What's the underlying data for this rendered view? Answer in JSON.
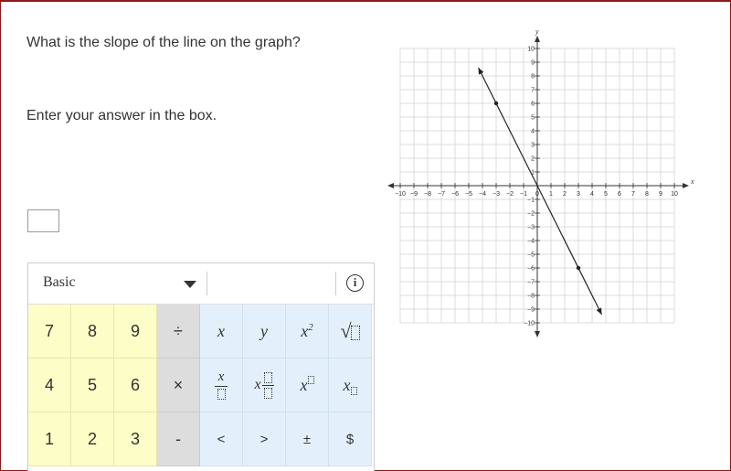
{
  "question": {
    "text": "What is the slope of the line on the graph?",
    "instruction": "Enter your answer in the box."
  },
  "answer_box": {
    "value": ""
  },
  "keyboard": {
    "mode": "Basic",
    "info_label": "i",
    "keys": {
      "row1": [
        "7",
        "8",
        "9",
        "÷",
        "x",
        "y",
        "x2",
        "√"
      ],
      "row2": [
        "4",
        "5",
        "6",
        "×",
        "x/□",
        "x□/□",
        "x□",
        "x□"
      ],
      "row3": [
        "1",
        "2",
        "3",
        "-",
        "<",
        ">",
        "±",
        "$"
      ]
    }
  },
  "graph": {
    "x_axis_label": "x",
    "y_axis_label": "y",
    "x_ticks": [
      "−10",
      "−9",
      "−8",
      "−7",
      "−6",
      "−5",
      "−4",
      "−3",
      "−2",
      "−1",
      "0",
      "1",
      "2",
      "3",
      "4",
      "5",
      "6",
      "7",
      "8",
      "9",
      "10"
    ],
    "y_ticks": [
      "10",
      "9",
      "8",
      "7",
      "6",
      "5",
      "4",
      "3",
      "2",
      "1",
      "−1",
      "−2",
      "−3",
      "−4",
      "−5",
      "−6",
      "−7",
      "−8",
      "−9",
      "−10"
    ],
    "xlim": [
      -10,
      10
    ],
    "ylim": [
      -10,
      10
    ],
    "grid": true,
    "line": {
      "slope": -2,
      "intercept": 0,
      "points": [
        [
          -3,
          6
        ],
        [
          3,
          -6
        ]
      ],
      "x_start": -4.3,
      "x_end": 4.7
    }
  }
}
